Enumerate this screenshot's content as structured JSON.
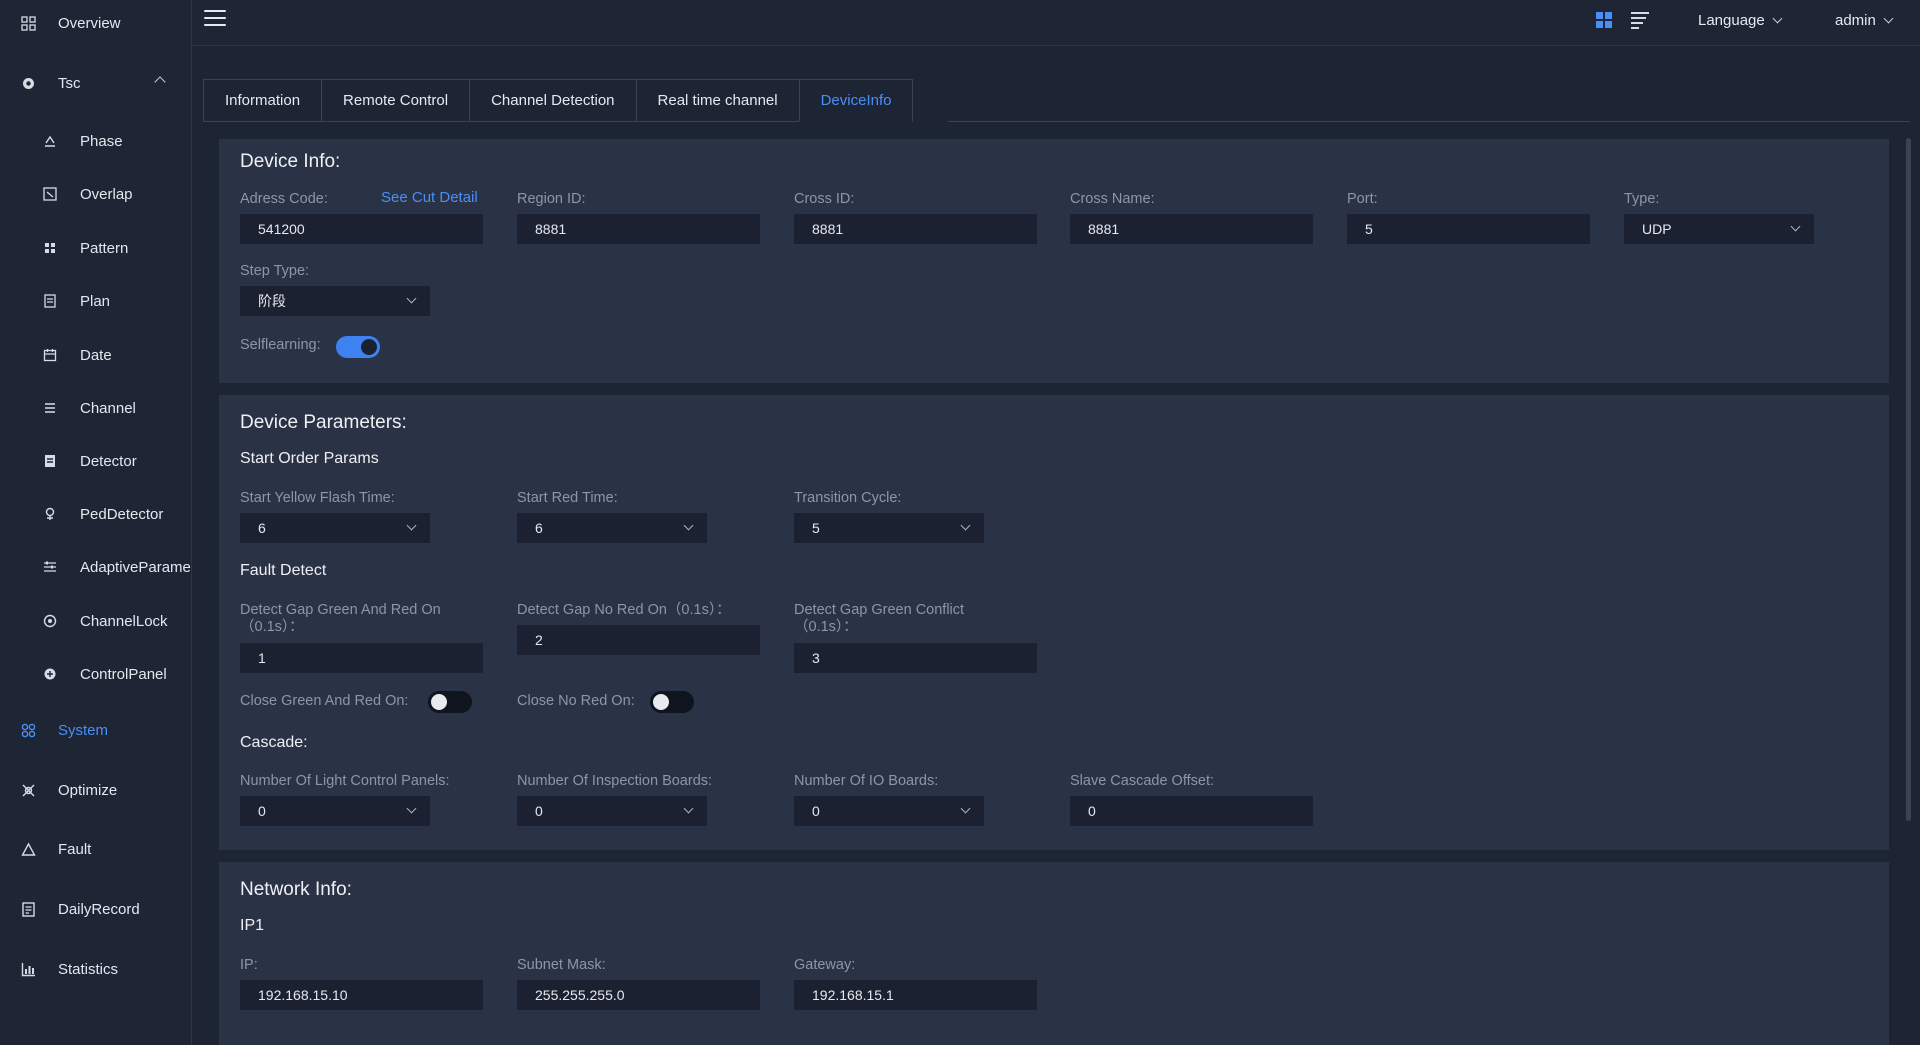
{
  "sidebar": {
    "items": [
      {
        "label": "Overview",
        "icon": "grid-icon"
      },
      {
        "label": "Tsc",
        "icon": "gear-icon"
      },
      {
        "label": "Phase",
        "icon": "phase-icon"
      },
      {
        "label": "Overlap",
        "icon": "overlap-icon"
      },
      {
        "label": "Pattern",
        "icon": "pattern-icon"
      },
      {
        "label": "Plan",
        "icon": "plan-icon"
      },
      {
        "label": "Date",
        "icon": "calendar-icon"
      },
      {
        "label": "Channel",
        "icon": "channel-icon"
      },
      {
        "label": "Detector",
        "icon": "detector-icon"
      },
      {
        "label": "PedDetector",
        "icon": "pedestrian-icon"
      },
      {
        "label": "AdaptiveParame",
        "icon": "sliders-icon"
      },
      {
        "label": "ChannelLock",
        "icon": "lock-icon"
      },
      {
        "label": "ControlPanel",
        "icon": "control-panel-icon"
      },
      {
        "label": "System",
        "icon": "system-icon"
      },
      {
        "label": "Optimize",
        "icon": "optimize-icon"
      },
      {
        "label": "Fault",
        "icon": "warning-icon"
      },
      {
        "label": "DailyRecord",
        "icon": "record-icon"
      },
      {
        "label": "Statistics",
        "icon": "bar-chart-icon"
      }
    ]
  },
  "header": {
    "language": "Language",
    "user": "admin",
    "accent_color": "#4a8ff7"
  },
  "tabs": [
    {
      "label": "Information"
    },
    {
      "label": "Remote Control"
    },
    {
      "label": "Channel Detection"
    },
    {
      "label": "Real time channel"
    },
    {
      "label": "DeviceInfo"
    }
  ],
  "device_info": {
    "title": "Device Info:",
    "address_code_label": "Adress Code:",
    "see_cut_detail": "See Cut Detail",
    "address_code": "541200",
    "region_id_label": "Region ID:",
    "region_id": "8881",
    "cross_id_label": "Cross ID:",
    "cross_id": "8881",
    "cross_name_label": "Cross Name:",
    "cross_name": "8881",
    "port_label": "Port:",
    "port": "5",
    "type_label": "Type:",
    "type": "UDP",
    "step_type_label": "Step Type:",
    "step_type": "阶段",
    "selflearning_label": "Selflearning:",
    "selflearning": true
  },
  "device_params": {
    "title": "Device Parameters:",
    "start_order_title": "Start Order Params",
    "yellow_flash_label": "Start Yellow Flash Time:",
    "yellow_flash": "6",
    "start_red_label": "Start Red Time:",
    "start_red": "6",
    "transition_label": "Transition Cycle:",
    "transition": "5",
    "fault_detect_title": "Fault Detect",
    "gap_green_red_label_1": "Detect Gap Green And Red On",
    "gap_green_red_label_2": "（0.1s）：",
    "gap_green_red": "1",
    "gap_no_red_label": "Detect Gap No Red On（0.1s）：",
    "gap_no_red": "2",
    "gap_conflict_label_1": "Detect Gap Green Conflict",
    "gap_conflict_label_2": "（0.1s）：",
    "gap_conflict": "3",
    "close_green_red_label": "Close Green And Red On:",
    "close_green_red": false,
    "close_no_red_label": "Close No Red On:",
    "close_no_red": false,
    "cascade_title": "Cascade:",
    "light_panels_label": "Number Of Light Control Panels:",
    "light_panels": "0",
    "inspection_boards_label": "Number Of Inspection Boards:",
    "inspection_boards": "0",
    "io_boards_label": "Number Of IO Boards:",
    "io_boards": "0",
    "slave_offset_label": "Slave Cascade Offset:",
    "slave_offset": "0"
  },
  "network": {
    "title": "Network Info:",
    "ip1_title": "IP1",
    "ip_label": "IP:",
    "ip": "192.168.15.10",
    "mask_label": "Subnet Mask:",
    "mask": "255.255.255.0",
    "gateway_label": "Gateway:",
    "gateway": "192.168.15.1"
  }
}
